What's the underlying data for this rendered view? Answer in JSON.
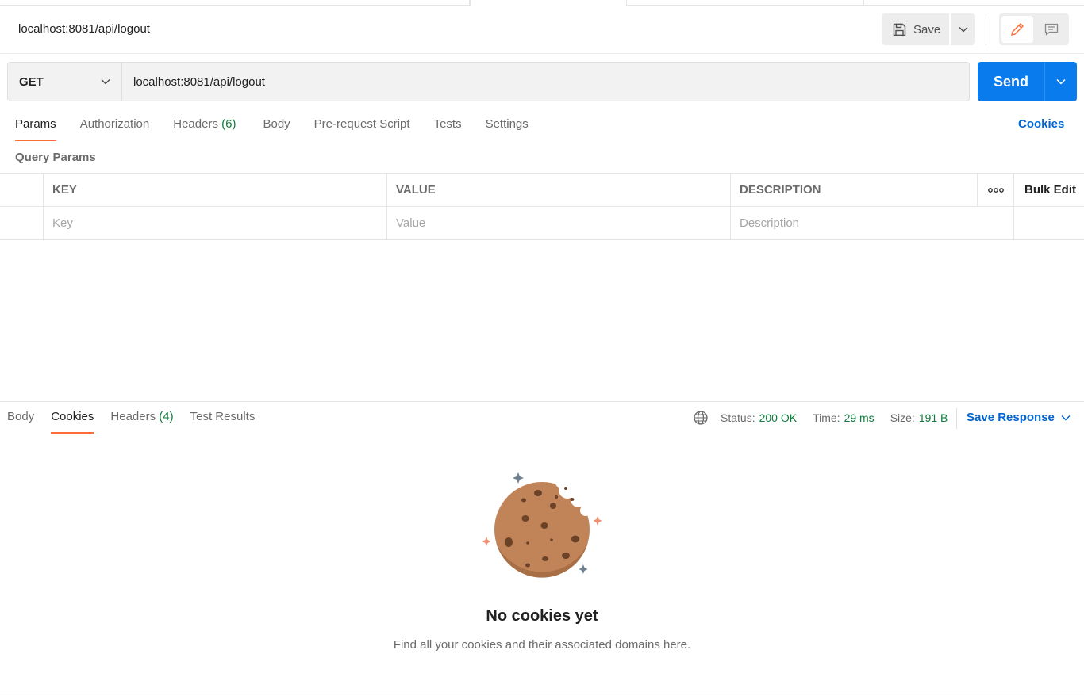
{
  "request": {
    "title": "localhost:8081/api/logout",
    "method": "GET",
    "url": "localhost:8081/api/logout"
  },
  "toolbar": {
    "save_label": "Save",
    "send_label": "Send"
  },
  "request_tabs": [
    {
      "label": "Params",
      "count": ""
    },
    {
      "label": "Authorization",
      "count": ""
    },
    {
      "label": "Headers",
      "count": "(6)"
    },
    {
      "label": "Body",
      "count": ""
    },
    {
      "label": "Pre-request Script",
      "count": ""
    },
    {
      "label": "Tests",
      "count": ""
    },
    {
      "label": "Settings",
      "count": ""
    }
  ],
  "cookies_link": "Cookies",
  "query_params": {
    "label": "Query Params",
    "headers": {
      "key": "KEY",
      "value": "VALUE",
      "description": "DESCRIPTION",
      "bulk_edit": "Bulk Edit"
    },
    "placeholders": {
      "key": "Key",
      "value": "Value",
      "description": "Description"
    }
  },
  "response": {
    "tabs": [
      {
        "label": "Body",
        "count": ""
      },
      {
        "label": "Cookies",
        "count": ""
      },
      {
        "label": "Headers",
        "count": "(4)"
      },
      {
        "label": "Test Results",
        "count": ""
      }
    ],
    "active_tab": "Cookies",
    "status_label": "Status:",
    "status_value": "200 OK",
    "time_label": "Time:",
    "time_value": "29 ms",
    "size_label": "Size:",
    "size_value": "191 B",
    "save_response": "Save Response",
    "empty_title": "No cookies yet",
    "empty_subtitle": "Find all your cookies and their associated domains here."
  },
  "colors": {
    "accent": "#ff6c37",
    "send": "#097bed",
    "link": "#0265d2",
    "success": "#0f7b3c"
  }
}
